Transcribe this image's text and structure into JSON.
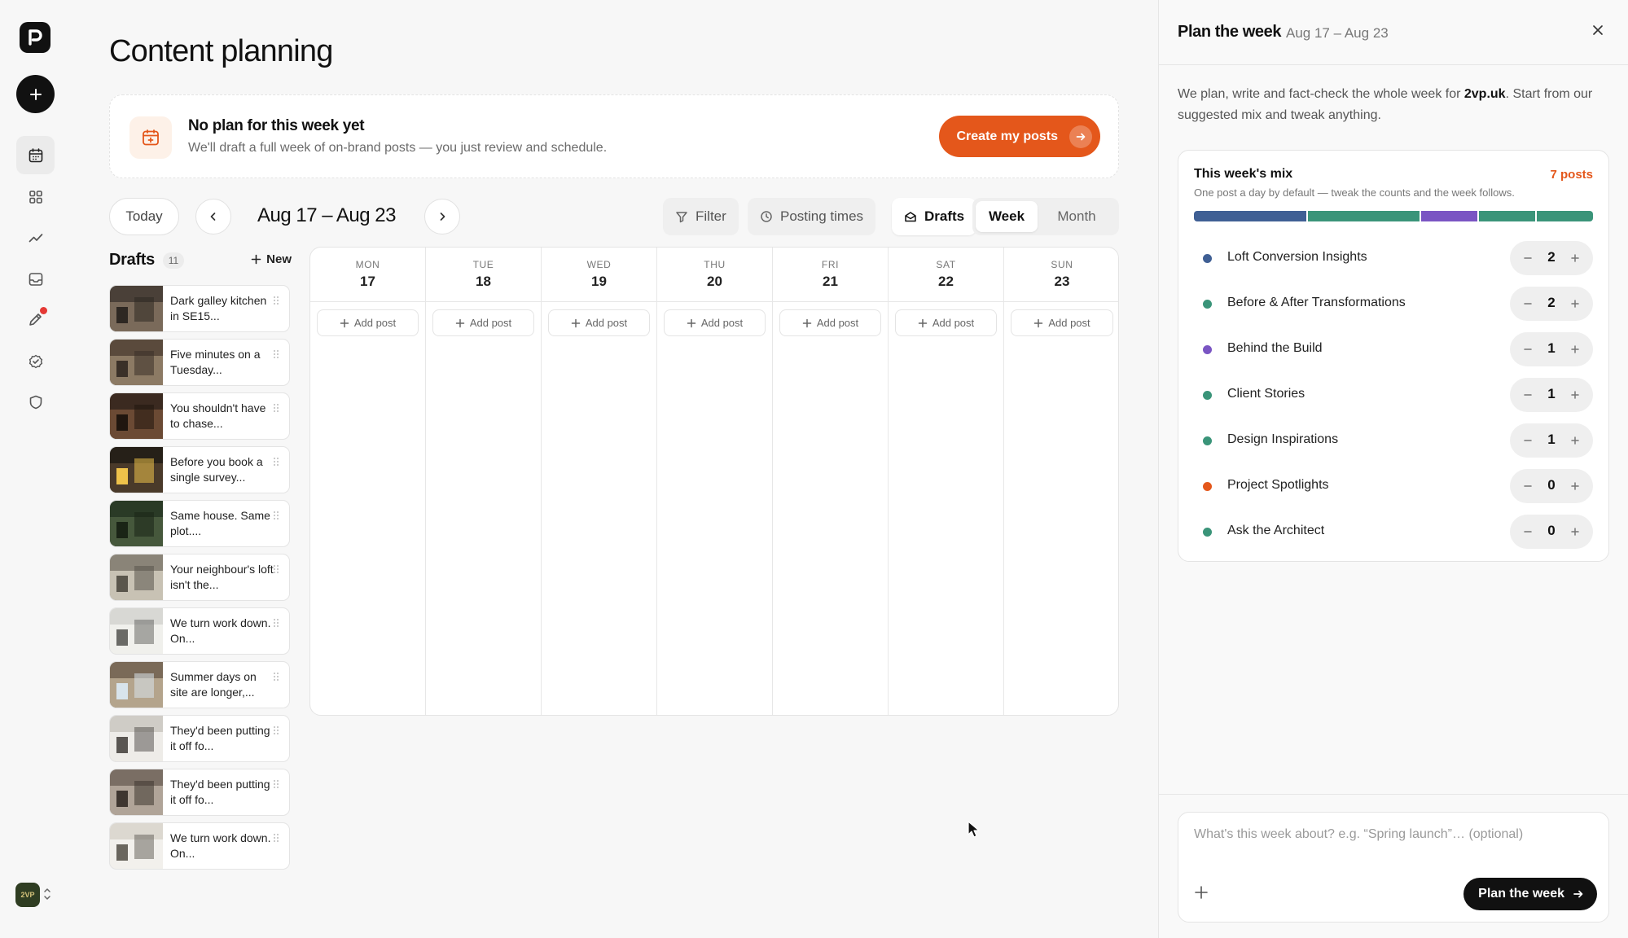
{
  "app": {
    "page_title": "Content planning",
    "avatar_label": "2VP"
  },
  "colors": {
    "accent": "#e4571b",
    "loft": "#3f5f94",
    "teal": "#3a9479",
    "purple": "#7a55c3",
    "orange": "#e4571b"
  },
  "rail": {
    "icons": [
      "calendar-icon",
      "grid-icon",
      "analytics-icon",
      "inbox-icon",
      "campaign-icon",
      "approval-icon",
      "shield-icon"
    ]
  },
  "banner": {
    "title": "No plan for this week yet",
    "subtitle": "We'll draft a full week of on-brand posts — you just review and schedule.",
    "cta_label": "Create my posts"
  },
  "toolbar": {
    "today_label": "Today",
    "range_label": "Aug 17 – Aug 23",
    "filter_label": "Filter",
    "posting_times_label": "Posting times",
    "drafts_label": "Drafts",
    "week_label": "Week",
    "month_label": "Month"
  },
  "drafts": {
    "title": "Drafts",
    "count": "11",
    "new_label": "New",
    "items": [
      {
        "text": "Dark galley kitchen in SE15..."
      },
      {
        "text": "Five minutes on a Tuesday..."
      },
      {
        "text": "You shouldn't have to chase..."
      },
      {
        "text": "Before you book a single survey..."
      },
      {
        "text": "Same house. Same plot...."
      },
      {
        "text": "Your neighbour's loft isn't the..."
      },
      {
        "text": "We turn work down. On..."
      },
      {
        "text": "Summer days on site are longer,..."
      },
      {
        "text": "They'd been putting it off fo..."
      },
      {
        "text": "They'd been putting it off fo..."
      },
      {
        "text": "We turn work down. On..."
      }
    ]
  },
  "calendar": {
    "add_label": "Add post",
    "days": [
      {
        "dow": "MON",
        "day": "17"
      },
      {
        "dow": "TUE",
        "day": "18"
      },
      {
        "dow": "WED",
        "day": "19"
      },
      {
        "dow": "THU",
        "day": "20"
      },
      {
        "dow": "FRI",
        "day": "21"
      },
      {
        "dow": "SAT",
        "day": "22"
      },
      {
        "dow": "SUN",
        "day": "23"
      }
    ]
  },
  "panel": {
    "title": "Plan the week",
    "range": "Aug 17 – Aug 23",
    "intro_before": "We plan, write and fact-check the whole week for ",
    "intro_domain": "2vp.uk",
    "intro_after": ". Start from our suggested mix and tweak anything.",
    "mix_title": "This week's mix",
    "mix_total": "7 posts",
    "mix_subtitle": "One post a day by default — tweak the counts and the week follows.",
    "mix": [
      {
        "name": "Loft Conversion Insights",
        "count": "2",
        "color": "#3f5f94"
      },
      {
        "name": "Before & After Transformations",
        "count": "2",
        "color": "#3a9479"
      },
      {
        "name": "Behind the Build",
        "count": "1",
        "color": "#7a55c3"
      },
      {
        "name": "Client Stories",
        "count": "1",
        "color": "#3a9479"
      },
      {
        "name": "Design Inspirations",
        "count": "1",
        "color": "#3a9479"
      },
      {
        "name": "Project Spotlights",
        "count": "0",
        "color": "#e4571b"
      },
      {
        "name": "Ask the Architect",
        "count": "0",
        "color": "#3a9479"
      }
    ],
    "composer_placeholder": "What's this week about? e.g. “Spring launch”… (optional)",
    "composer_button": "Plan the week"
  }
}
